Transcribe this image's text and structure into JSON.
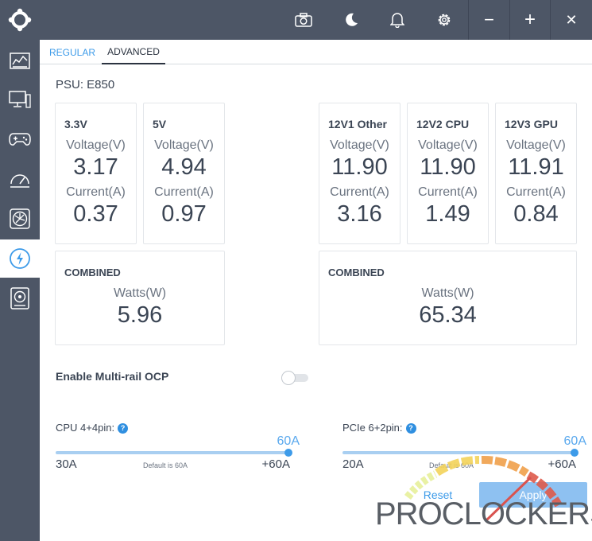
{
  "titlebar": {
    "icons": [
      "camera-icon",
      "moon-icon",
      "bell-icon",
      "gear-icon",
      "minimize-icon",
      "maximize-icon",
      "close-icon"
    ],
    "minimize_label": "−",
    "maximize_label": "+",
    "close_label": "✕"
  },
  "sidebar": {
    "items": [
      "dashboard-icon",
      "monitor-icon",
      "gamepad-icon",
      "speedometer-icon",
      "fan-icon",
      "power-icon",
      "storage-icon"
    ],
    "active": "power-icon"
  },
  "tabs": [
    {
      "label": "REGULAR",
      "active": false
    },
    {
      "label": "ADVANCED",
      "active": true
    }
  ],
  "psu": {
    "label": "PSU: E850"
  },
  "rails": [
    {
      "name": "3.3V",
      "voltage_label": "Voltage(V)",
      "voltage": "3.17",
      "current_label": "Current(A)",
      "current": "0.37"
    },
    {
      "name": "5V",
      "voltage_label": "Voltage(V)",
      "voltage": "4.94",
      "current_label": "Current(A)",
      "current": "0.97"
    },
    {
      "name": "12V1 Other",
      "voltage_label": "Voltage(V)",
      "voltage": "11.90",
      "current_label": "Current(A)",
      "current": "3.16"
    },
    {
      "name": "12V2 CPU",
      "voltage_label": "Voltage(V)",
      "voltage": "11.90",
      "current_label": "Current(A)",
      "current": "1.49"
    },
    {
      "name": "12V3 GPU",
      "voltage_label": "Voltage(V)",
      "voltage": "11.91",
      "current_label": "Current(A)",
      "current": "0.84"
    }
  ],
  "combined": [
    {
      "title": "COMBINED",
      "watts_label": "Watts(W)",
      "watts": "5.96"
    },
    {
      "title": "COMBINED",
      "watts_label": "Watts(W)",
      "watts": "65.34"
    }
  ],
  "ocp": {
    "label": "Enable Multi-rail OCP",
    "enabled": false
  },
  "sliders": [
    {
      "label": "CPU 4+4pin:",
      "help": "?",
      "current": "60A",
      "min": "30A",
      "max": "+60A",
      "default_text": "Default is 60A",
      "fraction": 1.0
    },
    {
      "label": "PCIe 6+2pin:",
      "help": "?",
      "current": "60A",
      "min": "20A",
      "max": "+60A",
      "default_text": "Default is 60A",
      "fraction": 1.0
    }
  ],
  "buttons": {
    "reset": "Reset",
    "apply": "Apply"
  },
  "watermark": {
    "text": "PROCLOCKERS"
  },
  "colors": {
    "accent": "#3d9be9",
    "sidebar": "#4d5666",
    "apply_bg": "#8ec1f1"
  }
}
